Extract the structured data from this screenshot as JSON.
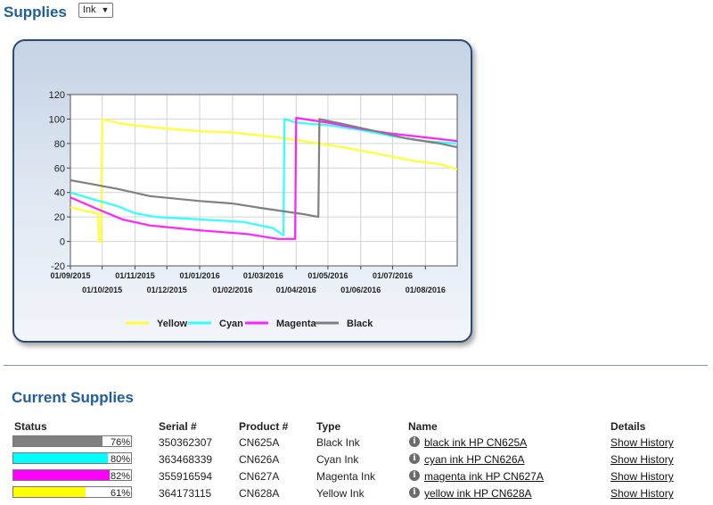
{
  "header": {
    "title": "Supplies",
    "select_value": "Ink"
  },
  "chart_data": {
    "type": "line",
    "ylim": [
      -20,
      120
    ],
    "yticks": [
      -20,
      0,
      20,
      40,
      60,
      80,
      100,
      120
    ],
    "xlim": [
      "2015-09-01",
      "2016-08-31"
    ],
    "xticks_upper": [
      "01/09/2015",
      "01/11/2015",
      "01/01/2016",
      "01/03/2016",
      "01/05/2016",
      "01/07/2016"
    ],
    "xticks_lower": [
      "01/10/2015",
      "01/12/2015",
      "01/02/2016",
      "01/04/2016",
      "01/06/2016",
      "01/08/2016"
    ],
    "grid": true,
    "legend_position": "bottom",
    "series": [
      {
        "name": "Yellow",
        "color": "#ffff33",
        "points": [
          [
            "2015-09-01",
            28
          ],
          [
            "2015-09-15",
            25
          ],
          [
            "2015-09-27",
            23
          ],
          [
            "2015-09-28",
            0
          ],
          [
            "2015-09-30",
            0
          ],
          [
            "2015-10-01",
            100
          ],
          [
            "2015-10-20",
            96
          ],
          [
            "2015-11-20",
            93
          ],
          [
            "2016-01-01",
            90
          ],
          [
            "2016-02-01",
            89
          ],
          [
            "2016-03-15",
            85
          ],
          [
            "2016-04-15",
            81
          ],
          [
            "2016-05-15",
            77
          ],
          [
            "2016-06-15",
            72
          ],
          [
            "2016-07-20",
            66
          ],
          [
            "2016-08-15",
            63
          ],
          [
            "2016-08-31",
            59
          ]
        ]
      },
      {
        "name": "Cyan",
        "color": "#33ffff",
        "points": [
          [
            "2015-09-01",
            40
          ],
          [
            "2015-09-20",
            35
          ],
          [
            "2015-10-15",
            29
          ],
          [
            "2015-11-01",
            23
          ],
          [
            "2015-11-20",
            20
          ],
          [
            "2016-01-01",
            18
          ],
          [
            "2016-02-10",
            16
          ],
          [
            "2016-03-10",
            11
          ],
          [
            "2016-03-20",
            5
          ],
          [
            "2016-03-21",
            100
          ],
          [
            "2016-04-01",
            97
          ],
          [
            "2016-05-01",
            95
          ],
          [
            "2016-06-01",
            91
          ],
          [
            "2016-07-01",
            86
          ],
          [
            "2016-08-01",
            82
          ],
          [
            "2016-08-31",
            80
          ]
        ]
      },
      {
        "name": "Magenta",
        "color": "#ff22ff",
        "points": [
          [
            "2015-09-01",
            36
          ],
          [
            "2015-09-25",
            27
          ],
          [
            "2015-10-20",
            18
          ],
          [
            "2015-11-15",
            13
          ],
          [
            "2016-01-01",
            9
          ],
          [
            "2016-02-15",
            6
          ],
          [
            "2016-03-15",
            2
          ],
          [
            "2016-03-31",
            2
          ],
          [
            "2016-04-01",
            101
          ],
          [
            "2016-05-01",
            97
          ],
          [
            "2016-06-01",
            92
          ],
          [
            "2016-07-01",
            88
          ],
          [
            "2016-08-01",
            85
          ],
          [
            "2016-08-31",
            82
          ]
        ]
      },
      {
        "name": "Black",
        "color": "#808080",
        "points": [
          [
            "2015-09-01",
            50
          ],
          [
            "2015-09-20",
            47
          ],
          [
            "2015-10-15",
            43
          ],
          [
            "2015-11-15",
            37
          ],
          [
            "2016-01-01",
            33
          ],
          [
            "2016-02-01",
            31
          ],
          [
            "2016-03-01",
            27
          ],
          [
            "2016-04-10",
            22
          ],
          [
            "2016-04-22",
            20
          ],
          [
            "2016-04-23",
            100
          ],
          [
            "2016-05-15",
            96
          ],
          [
            "2016-06-15",
            90
          ],
          [
            "2016-07-15",
            84
          ],
          [
            "2016-08-15",
            80
          ],
          [
            "2016-08-31",
            77
          ]
        ]
      }
    ]
  },
  "section": {
    "title": "Current Supplies"
  },
  "table": {
    "headers": {
      "status": "Status",
      "serial": "Serial #",
      "product": "Product #",
      "type": "Type",
      "name": "Name",
      "details": "Details"
    },
    "rows": [
      {
        "level": 0.76,
        "pct": "76%",
        "color": "#808080",
        "serial": "350362307",
        "product": "CN625A",
        "type": "Black Ink",
        "name": "black ink HP CN625A",
        "details": "Show History"
      },
      {
        "level": 0.8,
        "pct": "80%",
        "color": "#00ffff",
        "serial": "363468339",
        "product": "CN626A",
        "type": "Cyan Ink",
        "name": "cyan ink HP CN626A",
        "details": "Show History"
      },
      {
        "level": 0.82,
        "pct": "82%",
        "color": "#ff00ff",
        "serial": "355916594",
        "product": "CN627A",
        "type": "Magenta Ink",
        "name": "magenta ink HP CN627A",
        "details": "Show History"
      },
      {
        "level": 0.61,
        "pct": "61%",
        "color": "#ffff00",
        "serial": "364173115",
        "product": "CN628A",
        "type": "Yellow Ink",
        "name": "yellow ink HP CN628A",
        "details": "Show History"
      }
    ]
  }
}
